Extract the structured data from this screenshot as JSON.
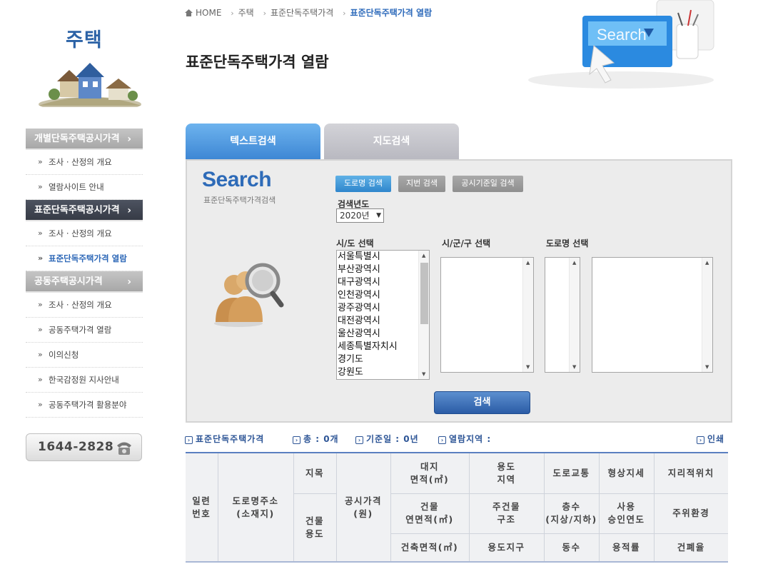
{
  "sidebar": {
    "title": "주택",
    "menu": [
      {
        "type": "head",
        "label": "개별단독주택공시가격",
        "chev": "›",
        "active": false
      },
      {
        "type": "item",
        "label": "조사 · 산정의 개요"
      },
      {
        "type": "item",
        "label": "열람사이트 안내"
      },
      {
        "type": "head",
        "label": "표준단독주택공시가격",
        "chev": "›",
        "active": true
      },
      {
        "type": "item",
        "label": "조사 · 산정의 개요"
      },
      {
        "type": "item",
        "label": "표준단독주택가격 열람",
        "on": true
      },
      {
        "type": "head",
        "label": "공동주택공시가격",
        "chev": "›",
        "active": false
      },
      {
        "type": "item",
        "label": "조사 · 산정의 개요"
      },
      {
        "type": "item",
        "label": "공동주택가격 열람"
      },
      {
        "type": "item",
        "label": "이의신청"
      },
      {
        "type": "item",
        "label": "한국감정원 지사안내"
      },
      {
        "type": "item",
        "label": "공동주택가격 활용분야"
      }
    ],
    "phone": "1644-2828"
  },
  "breadcrumb": {
    "home": "HOME",
    "items": [
      "주택",
      "표준단독주택가격"
    ],
    "current": "표준단독주택가격 열람"
  },
  "page_title": "표준단독주택가격 열람",
  "header_illustration_text": "Search",
  "tabs": {
    "text": "텍스트검색",
    "map": "지도검색"
  },
  "search": {
    "logo": "Search",
    "logo_sub": "표준단독주택가격검색",
    "type_buttons": {
      "road": "도로명 검색",
      "lot": "지번 검색",
      "date": "공시기준일 검색"
    },
    "year_label": "검색년도",
    "year_value": "2020년",
    "sido_label": "시/도 선택",
    "sigungu_label": "시/군/구 선택",
    "road_label": "도로명 선택",
    "sido_options": [
      "서울특별시",
      "부산광역시",
      "대구광역시",
      "인천광역시",
      "광주광역시",
      "대전광역시",
      "울산광역시",
      "세종특별자치시",
      "경기도",
      "강원도"
    ],
    "submit": "검색"
  },
  "info_bar": {
    "title": "표준단독주택가격",
    "total": "총 : 0개",
    "base_date": "기준일 : 0년",
    "region": "열람지역 :",
    "print": "인쇄"
  },
  "table": {
    "serial": "일련\n번호",
    "address": "도로명주소\n(소재지)",
    "jimok": "지목",
    "bldg_use": "건물\n용도",
    "price": "공시가격\n(원)",
    "land_area": "대지\n면적(㎡)",
    "zone": "용도\n지역",
    "road": "도로교통",
    "shape": "형상지세",
    "location": "지리적위치",
    "floor_area": "건물\n연면적(㎡)",
    "structure": "주건물\n구조",
    "floors": "층수\n(지상/지하)",
    "approval": "사용\n승인연도",
    "surround": "주위환경",
    "building_area": "건축면적(㎡)",
    "district": "용도지구",
    "units": "동수",
    "far": "용적률",
    "bcr": "건폐율"
  },
  "colors": {
    "accent_blue": "#2e6bbb",
    "tab_active": "#4a94de",
    "tab_inactive": "#c6c6cc",
    "menu_active": "#3d424d"
  }
}
